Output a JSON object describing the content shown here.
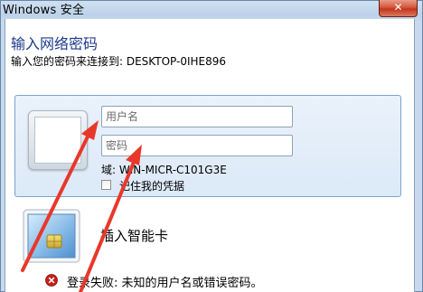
{
  "window": {
    "title": "Windows 安全",
    "close_symbol": "✕"
  },
  "dialog": {
    "heading": "输入网络密码",
    "subheading": "输入您的密码来连接到: DESKTOP-0IHE896"
  },
  "credentials": {
    "username_placeholder": "用户名",
    "password_placeholder": "密码",
    "domain_text": "域: WIN-MICR-C101G3E",
    "remember_label": "记住我的凭据",
    "remember_checked": false
  },
  "smartcard": {
    "label": "插入智能卡"
  },
  "error": {
    "message": "登录失败: 未知的用户名或错误密码。"
  },
  "colors": {
    "heading": "#1e3a8a",
    "annotation_arrow": "#e8382a",
    "close_button": "#c3341c",
    "error_icon": "#c8201a"
  },
  "icons": {
    "close": "close-icon",
    "user": "user-tile-icon",
    "smartcard": "smartcard-icon",
    "error": "error-icon",
    "checkbox": "checkbox-icon"
  }
}
